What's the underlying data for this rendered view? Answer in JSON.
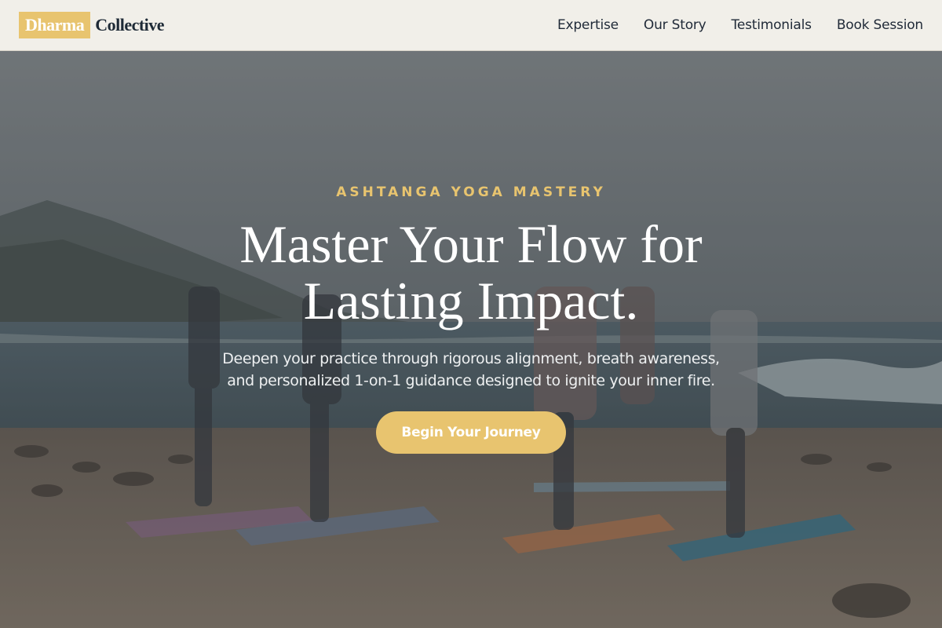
{
  "brand": {
    "highlight": "Dharma",
    "rest": "Collective"
  },
  "nav": {
    "items": [
      {
        "label": "Expertise"
      },
      {
        "label": "Our Story"
      },
      {
        "label": "Testimonials"
      },
      {
        "label": "Book Session"
      }
    ]
  },
  "hero": {
    "eyebrow": "ASHTANGA YOGA MASTERY",
    "headline_line1": "Master Your Flow for",
    "headline_line2": "Lasting Impact.",
    "subtitle_line1": "Deepen your practice through rigorous alignment, breath awareness,",
    "subtitle_line2": "and personalized 1-on-1 guidance designed to ignite your inner fire.",
    "cta_label": "Begin Your Journey"
  },
  "colors": {
    "accent": "#e8c46f",
    "header_bg": "#f1efe9",
    "text_dark": "#1e2a36"
  }
}
